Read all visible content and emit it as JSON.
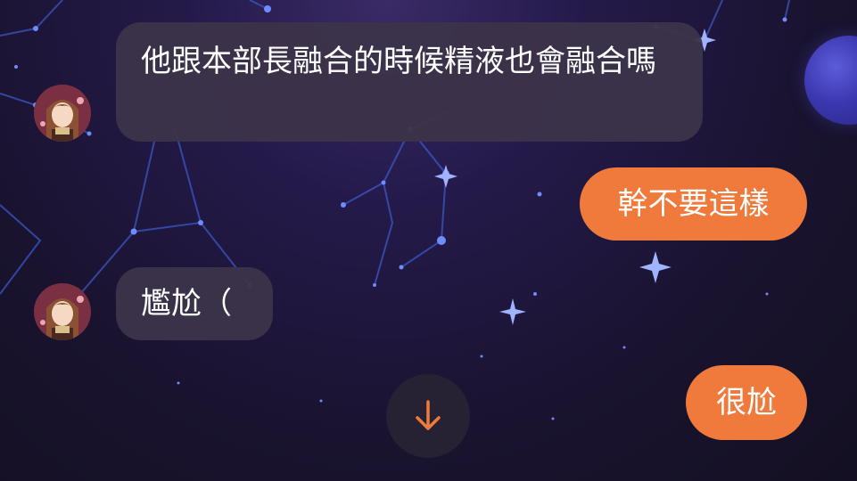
{
  "messages": [
    {
      "side": "incoming",
      "text": "他跟本部長融合的時候精液也會融合嗎"
    },
    {
      "side": "outgoing",
      "text": "幹不要這樣"
    },
    {
      "side": "incoming",
      "text": "尷尬（"
    },
    {
      "side": "outgoing",
      "text": "很尬"
    }
  ],
  "colors": {
    "outgoing_bubble": "#ef7a3c",
    "incoming_bubble": "#3c344a",
    "accent_arrow": "#f07a3a"
  },
  "icons": {
    "scroll_down": "arrow-down-icon",
    "avatar": "anime-girl-avatar"
  }
}
